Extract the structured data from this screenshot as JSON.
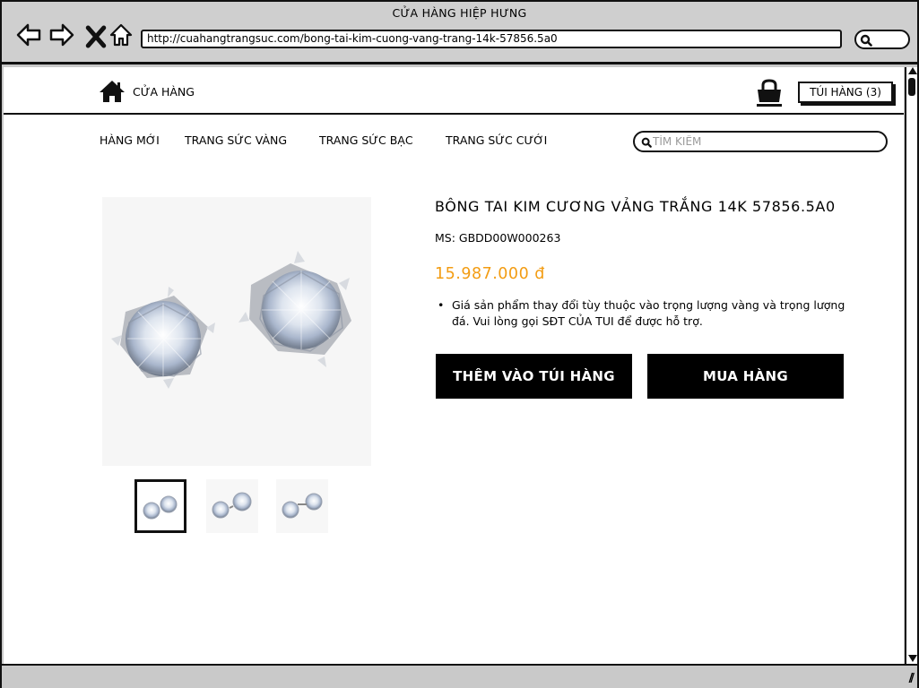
{
  "window": {
    "title": "CỬA HÀNG HIỆP HƯNG",
    "url": "http://cuahangtrangsuc.com/bong-tai-kim-cuong-vang-trang-14k-57856.5a0"
  },
  "header": {
    "brand": "CỬA HÀNG",
    "cart_label": "TÚI HÀNG (3)"
  },
  "nav": {
    "items": [
      "HÀNG MỚI",
      "TRANG SỨC VÀNG",
      "TRANG SỨC BẠC",
      "TRANG SỨC CƯỚI"
    ],
    "search_placeholder": "TÌM KIẾM"
  },
  "product": {
    "title": "BÔNG TAI KIM CƯƠNG VẢNG TRẮNG 14K 57856.5A0",
    "sku": "MS: GBDD00W000263",
    "price": "15.987.000 đ",
    "note": "Giá sản phẩm thay đổi tùy thuộc vào trọng lượng vàng và trọng lượng đá. Vui lòng gọi SĐT CỦA TUI để được hỗ trợ.",
    "add_to_bag": "THÊM VÀO TÚI HÀNG",
    "buy_now": "MUA HÀNG",
    "thumbnail_count": 3,
    "selected_thumbnail": 1
  },
  "colors": {
    "price": "#f39c12",
    "button_bg": "#000000",
    "button_text": "#ffffff"
  },
  "icons": [
    "back-arrow-icon",
    "forward-arrow-icon",
    "close-icon",
    "home-icon",
    "search-icon",
    "shopping-bag-icon",
    "resize-grip-icon"
  ]
}
